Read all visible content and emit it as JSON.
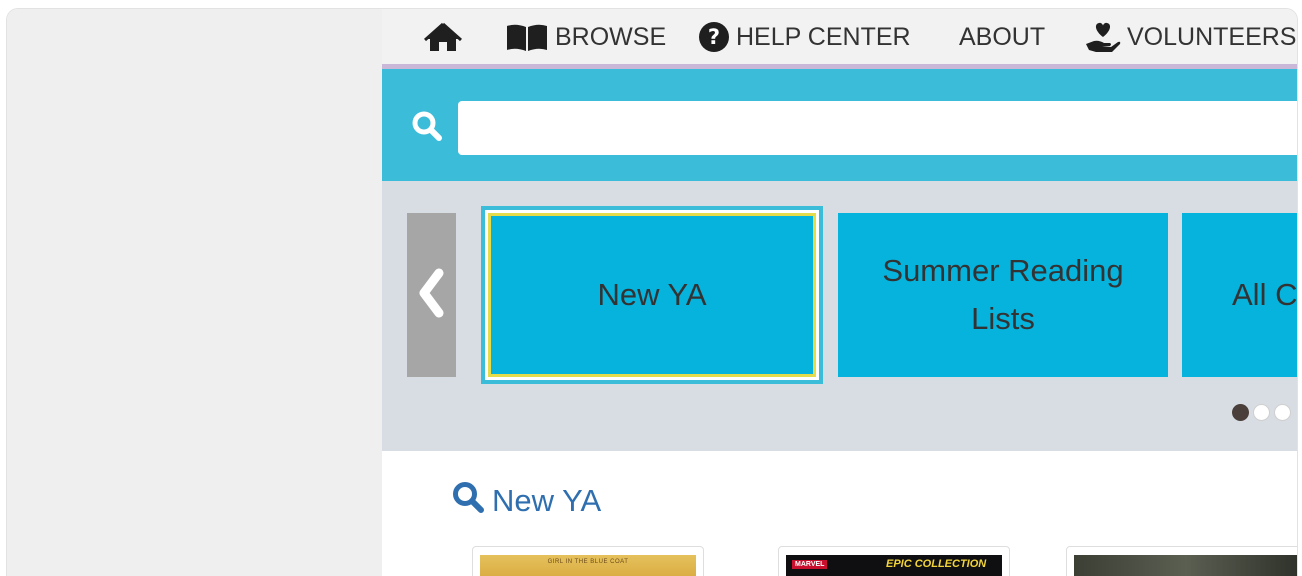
{
  "nav": {
    "home_icon": "home-icon",
    "browse_label": "BROWSE",
    "browse_icon": "open-book-icon",
    "help_label": "HELP CENTER",
    "help_icon": "question-circle-icon",
    "about_label": "ABOUT",
    "volunteers_label": "VOLUNTEERS",
    "volunteers_icon": "heart-hand-icon"
  },
  "search": {
    "placeholder": "",
    "value": "",
    "icon": "search-icon"
  },
  "carousel": {
    "prev_icon": "chevron-left-icon",
    "tiles": [
      {
        "label": "New YA",
        "active": true
      },
      {
        "label": "Summer Reading Lists",
        "active": false
      },
      {
        "label": "All C",
        "active": false
      }
    ],
    "dots": {
      "active_index": 0
    }
  },
  "section": {
    "title": "New YA",
    "icon": "search-icon",
    "books": [
      {
        "caption": "GIRL IN THE BLUE COAT"
      },
      {
        "caption": "EPIC COLLECTION",
        "publisher": "MARVEL"
      },
      {
        "caption": ""
      }
    ]
  },
  "colors": {
    "accent_cyan": "#3bbcd8",
    "tile_blue": "#05b3dd",
    "highlight_yellow": "#e4dc4a",
    "link_blue": "#2f6fb0",
    "nav_stripe": "#c9b8d8"
  }
}
